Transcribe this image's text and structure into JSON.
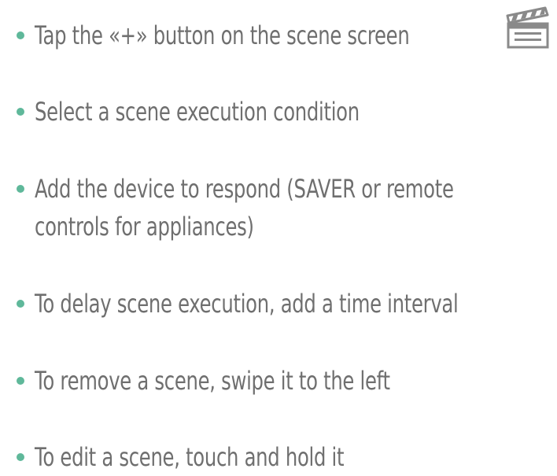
{
  "steps": [
    {
      "lines": [
        "Tap the «+» button on the scene screen"
      ]
    },
    {
      "lines": [
        "Select a scene execution condition"
      ]
    },
    {
      "lines": [
        "Add the device to respond (SAVER or remote",
        "controls for appliances)"
      ]
    },
    {
      "lines": [
        "To delay scene execution, add a time interval"
      ]
    },
    {
      "lines": [
        "To remove a scene, swipe it to the left"
      ]
    },
    {
      "lines": [
        "To edit a scene, touch and hold it"
      ]
    }
  ],
  "icons": {
    "scene_icon": "clapperboard-icon"
  },
  "colors": {
    "text": "#6f6f6f",
    "bullet": "#5fb89a",
    "icon": "#8a8a8a"
  }
}
